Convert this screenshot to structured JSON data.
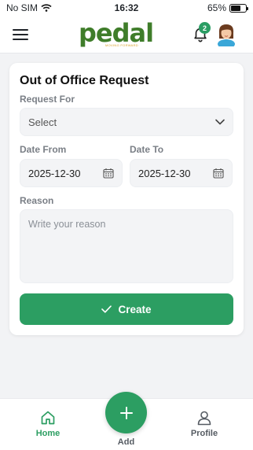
{
  "status_bar": {
    "carrier": "No SIM",
    "time": "16:32",
    "battery_percent": "65%",
    "battery_level": 0.65,
    "icons": [
      "wifi-icon",
      "battery-icon"
    ]
  },
  "header": {
    "logo_text": "pedal",
    "logo_tagline": "MOVING FORWARD",
    "notification_count": "2",
    "icons": [
      "menu-icon",
      "bell-icon",
      "avatar"
    ]
  },
  "form": {
    "title": "Out of Office Request",
    "request_for_label": "Request For",
    "request_for_value": "Select",
    "date_from_label": "Date From",
    "date_from_value": "2025-12-30",
    "date_to_label": "Date To",
    "date_to_value": "2025-12-30",
    "reason_label": "Reason",
    "reason_placeholder": "Write your reason",
    "create_label": "Create"
  },
  "bottom_nav": {
    "home_label": "Home",
    "add_label": "Add",
    "profile_label": "Profile"
  },
  "colors": {
    "accent": "#2c9e62",
    "logo_green": "#3f7d2a",
    "logo_gold": "#d9a229"
  }
}
